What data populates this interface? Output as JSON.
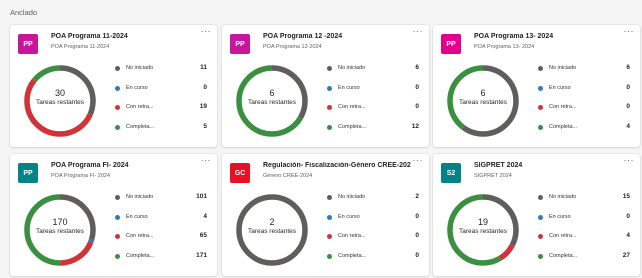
{
  "section_label": "Anclado",
  "center_caption": "Tareas restantes",
  "legend_labels": [
    "No iniciado",
    "En curso",
    "Con retra...",
    "Completa..."
  ],
  "colors": {
    "not_started": "#605e5c",
    "in_progress": "#2e7bbf",
    "late": "#d13438",
    "completed": "#3b8f40"
  },
  "cards": [
    {
      "initials": "PP",
      "avatar_color": "#c7169c",
      "title": "POA Programa 11-2024",
      "subtitle": "POA Programa 11-2024",
      "remaining": "30",
      "stats": [
        11,
        0,
        19,
        5
      ]
    },
    {
      "initials": "PP",
      "avatar_color": "#c7169c",
      "title": "POA Programa 12 -2024",
      "subtitle": "POA Programa 12-2024",
      "remaining": "6",
      "stats": [
        6,
        0,
        0,
        12
      ]
    },
    {
      "initials": "PP",
      "avatar_color": "#e3008c",
      "title": "POA Programa 13- 2024",
      "subtitle": "POA Programa 13- 2024",
      "remaining": "6",
      "stats": [
        6,
        0,
        0,
        4
      ]
    },
    {
      "initials": "PP",
      "avatar_color": "#038387",
      "title": "POA Programa FI- 2024",
      "subtitle": "POA Programa FI- 2024",
      "remaining": "170",
      "stats": [
        101,
        4,
        65,
        171
      ]
    },
    {
      "initials": "GC",
      "avatar_color": "#e81123",
      "title": "Regulación- Fiscalización-Género CREE-2024",
      "subtitle": "Género CREE-2024",
      "remaining": "2",
      "stats": [
        2,
        0,
        0,
        0
      ]
    },
    {
      "initials": "S2",
      "avatar_color": "#038387",
      "title": "SIGPRET 2024",
      "subtitle": "SIGPRET 2024",
      "remaining": "19",
      "stats": [
        15,
        0,
        4,
        27
      ]
    }
  ]
}
